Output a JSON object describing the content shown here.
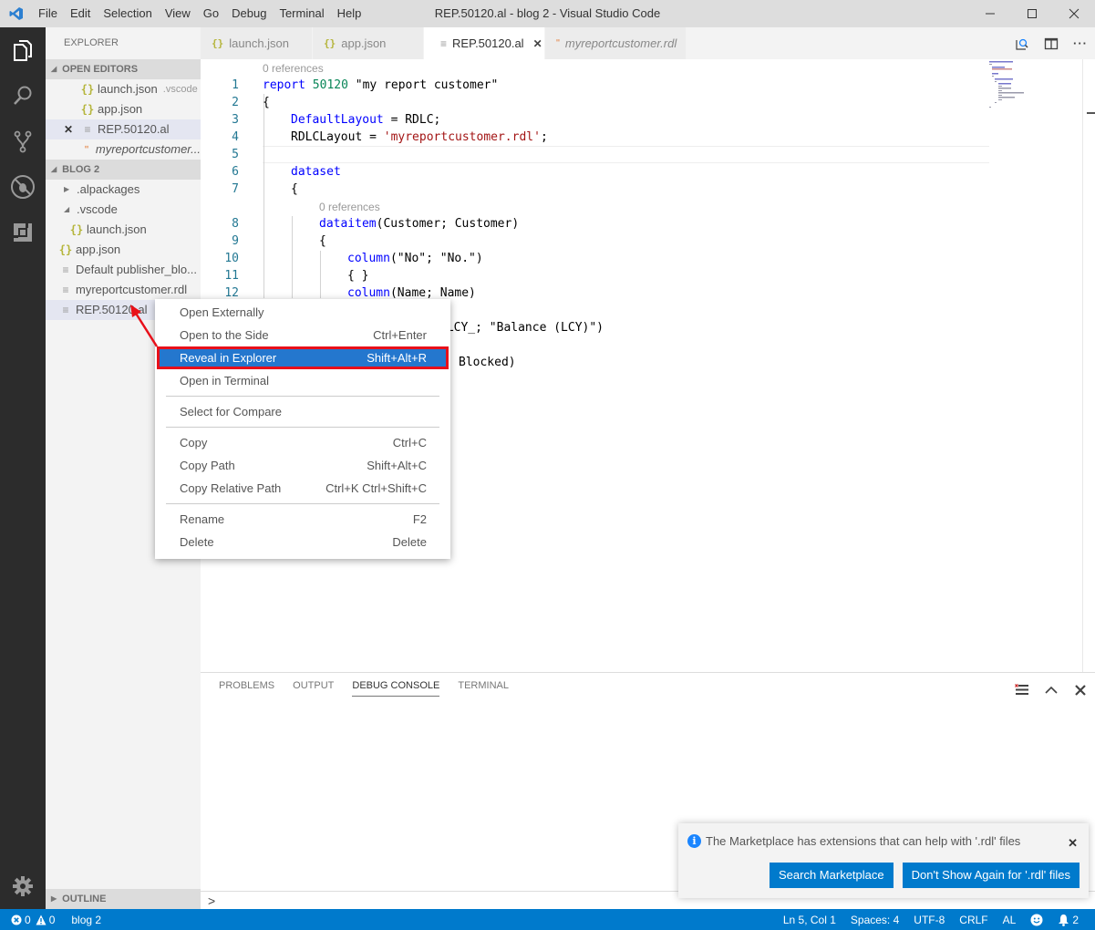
{
  "window": {
    "title": "REP.50120.al - blog 2 - Visual Studio Code",
    "menu": [
      "File",
      "Edit",
      "Selection",
      "View",
      "Go",
      "Debug",
      "Terminal",
      "Help"
    ]
  },
  "sidebar": {
    "title": "EXPLORER",
    "open_editors": {
      "label": "OPEN EDITORS",
      "items": [
        {
          "name": "launch.json",
          "hint": ".vscode",
          "icon": "json-icon"
        },
        {
          "name": "app.json",
          "icon": "json-icon"
        },
        {
          "name": "REP.50120.al",
          "icon": "file-icon",
          "selected": true
        },
        {
          "name": "myreportcustomer...",
          "icon": "rss-icon",
          "italic": true
        }
      ]
    },
    "folder": {
      "label": "BLOG 2",
      "items": [
        {
          "name": ".alpackages",
          "type": "folder-collapsed"
        },
        {
          "name": ".vscode",
          "type": "folder-expanded"
        },
        {
          "name": "launch.json",
          "type": "json"
        },
        {
          "name": "app.json",
          "type": "json"
        },
        {
          "name": "Default publisher_blo...",
          "type": "file"
        },
        {
          "name": "myreportcustomer.rdl",
          "type": "file"
        },
        {
          "name": "REP.50120.al",
          "type": "file"
        }
      ]
    },
    "outline_label": "OUTLINE"
  },
  "tabs": [
    {
      "label": "launch.json",
      "icon": "json-icon"
    },
    {
      "label": "app.json",
      "icon": "json-icon"
    },
    {
      "label": "REP.50120.al",
      "icon": "file-icon",
      "active": true
    },
    {
      "label": "myreportcustomer.rdl",
      "icon": "rss-icon",
      "italic": true
    }
  ],
  "editor": {
    "codelens": "0 references",
    "lines": {
      "1": [
        "report",
        "50120",
        "\"my report customer\""
      ],
      "3": [
        "DefaultLayout",
        " = RDLC;"
      ],
      "4": [
        "RDLCLayout = ",
        "'myreportcustomer.rdl'",
        ";"
      ],
      "6": "dataset",
      "7": "{",
      "2": "{",
      "8": [
        "dataitem",
        "(Customer; Customer)"
      ],
      "9": "{",
      "10": [
        "column",
        "(\"No\"; \"No.\")"
      ],
      "11": "{ }",
      "12": [
        "column",
        "(Name; Name)"
      ],
      "14": "_LCY_; \"Balance (LCY)\")",
      "16": "Blocked)"
    },
    "line_numbers": [
      "1",
      "2",
      "3",
      "4",
      "5",
      "6",
      "7",
      "8",
      "9",
      "10",
      "11",
      "12"
    ]
  },
  "context_menu": {
    "items": [
      {
        "label": "Open Externally",
        "shortcut": ""
      },
      {
        "label": "Open to the Side",
        "shortcut": "Ctrl+Enter"
      },
      {
        "label": "Reveal in Explorer",
        "shortcut": "Shift+Alt+R",
        "highlighted": true
      },
      {
        "label": "Open in Terminal",
        "shortcut": ""
      },
      {
        "label": "Select for Compare",
        "shortcut": ""
      },
      {
        "label": "Copy",
        "shortcut": "Ctrl+C"
      },
      {
        "label": "Copy Path",
        "shortcut": "Shift+Alt+C"
      },
      {
        "label": "Copy Relative Path",
        "shortcut": "Ctrl+K Ctrl+Shift+C"
      },
      {
        "label": "Rename",
        "shortcut": "F2"
      },
      {
        "label": "Delete",
        "shortcut": "Delete"
      }
    ]
  },
  "panel": {
    "tabs": [
      "PROBLEMS",
      "OUTPUT",
      "DEBUG CONSOLE",
      "TERMINAL"
    ],
    "active_tab": "DEBUG CONSOLE",
    "prompt": ">"
  },
  "notification": {
    "message": "The Marketplace has extensions that can help with '.rdl' files",
    "buttons": [
      "Search Marketplace",
      "Don't Show Again for '.rdl' files"
    ]
  },
  "statusbar": {
    "errors": "0",
    "warnings": "0",
    "folder": "blog 2",
    "position": "Ln 5, Col 1",
    "spaces": "Spaces: 4",
    "encoding": "UTF-8",
    "eol": "CRLF",
    "language": "AL",
    "notifications": "2"
  },
  "colors": {
    "accent": "#007acc",
    "highlight": "#2477ce",
    "annotation_red": "#e8101a"
  }
}
